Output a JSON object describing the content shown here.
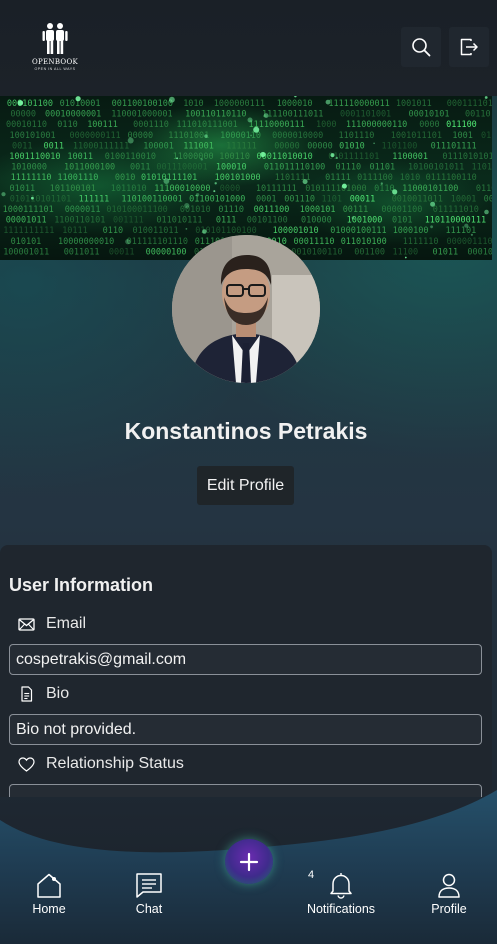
{
  "app": {
    "logo_name": "OPENBOOK",
    "logo_tagline": "OPEN IN ALL WAYS"
  },
  "header": {
    "search_icon": "search-icon",
    "logout_icon": "logout-icon"
  },
  "profile": {
    "name": "Konstantinos Petrakis",
    "edit_button": "Edit Profile"
  },
  "user_info": {
    "title": "User Information",
    "email_label": "Email",
    "email_value": "cospetrakis@gmail.com",
    "bio_label": "Bio",
    "bio_value": "Bio not provided.",
    "relationship_label": "Relationship Status"
  },
  "nav": {
    "home": "Home",
    "chat": "Chat",
    "notifications": "Notifications",
    "notifications_count": "4",
    "profile": "Profile"
  },
  "colors": {
    "accent_green": "#2bd96b",
    "fab_purple": "#6a2bb0",
    "card_bg": "#1f262e"
  }
}
